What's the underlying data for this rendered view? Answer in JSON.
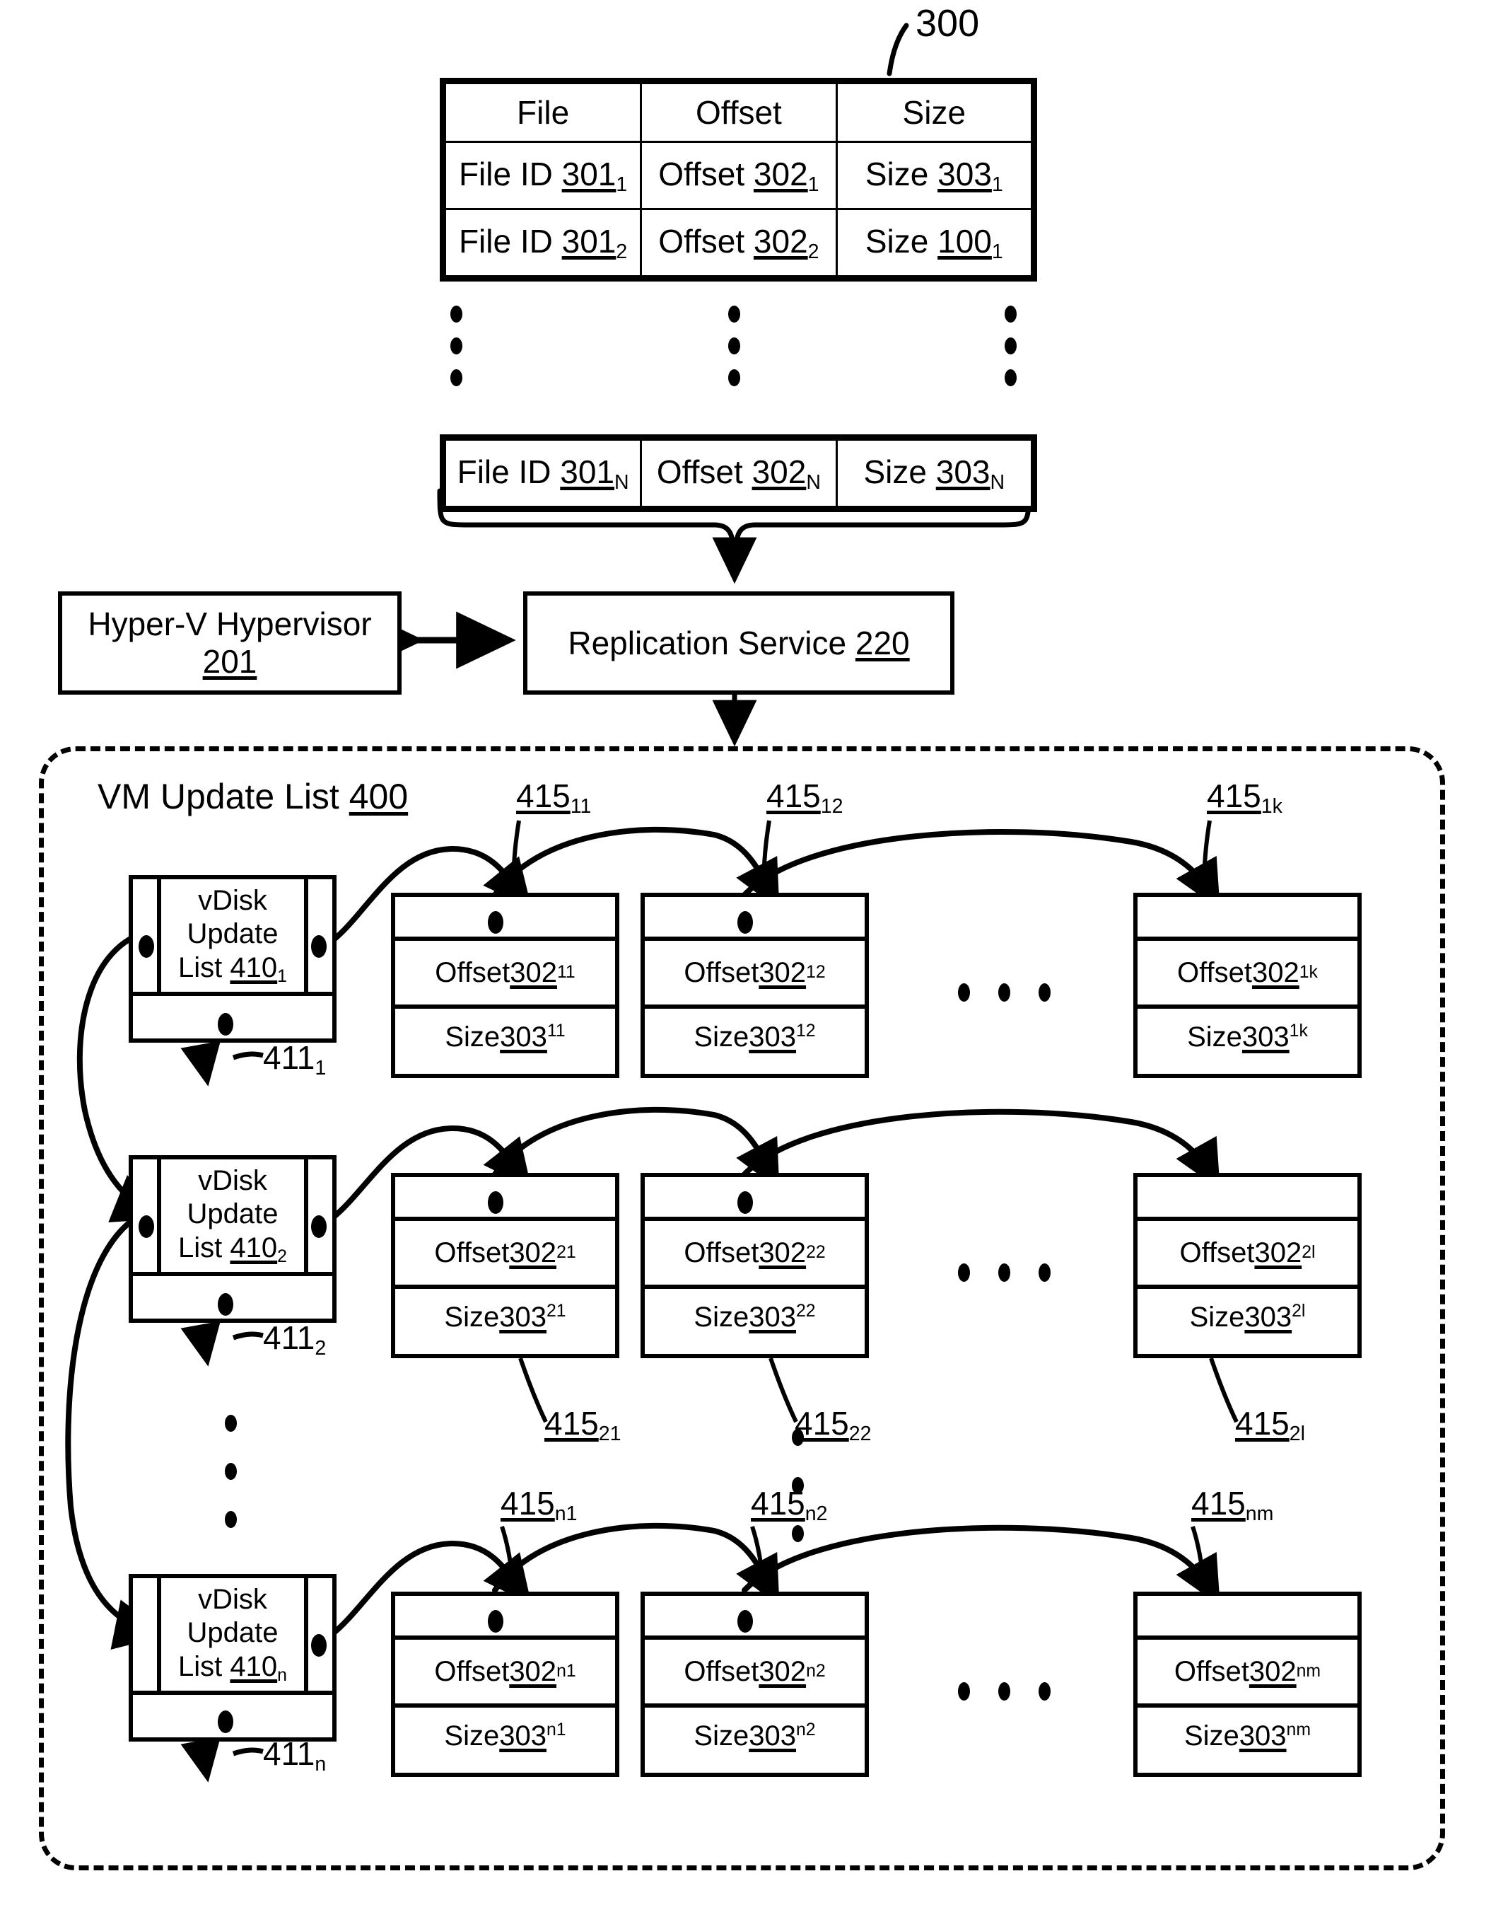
{
  "figure": {
    "table_ref": "300",
    "table": {
      "headers": [
        "File",
        "Offset",
        "Size"
      ],
      "rows": [
        {
          "file": "File ID 301",
          "file_sub": "1",
          "offset": "Offset 302",
          "offset_sub": "1",
          "size": "Size 303",
          "size_sub": "1"
        },
        {
          "file": "File ID 301",
          "file_sub": "2",
          "offset": "Offset 302",
          "offset_sub": "2",
          "size": "Size 100",
          "size_sub": "1"
        }
      ],
      "last_row": {
        "file": "File ID 301",
        "file_sub": "N",
        "offset": "Offset 302",
        "offset_sub": "N",
        "size": "Size 303",
        "size_sub": "N"
      },
      "ellipsis": "vertical-dots"
    },
    "hypervisor": {
      "label": "Hyper-V Hypervisor",
      "ref": "201"
    },
    "replication_service": {
      "label": "Replication Service ",
      "ref": "220"
    },
    "vm_update_list": {
      "label": "VM Update List ",
      "ref": "400",
      "rows": [
        {
          "vdisk": {
            "line1": "vDisk",
            "line2": "Update",
            "line3": "List ",
            "ref": "410",
            "ref_sub": "1"
          },
          "next_ptr_label": "411",
          "next_ptr_sub": "1",
          "entries": [
            {
              "ptr_label": "415",
              "ptr_sub": "11",
              "offset": "Offset 302",
              "offset_sub": "11",
              "size": "Size 303",
              "size_sub": "11",
              "label_pos": "above"
            },
            {
              "ptr_label": "415",
              "ptr_sub": "12",
              "offset": "Offset 302",
              "offset_sub": "12",
              "size": "Size 303",
              "size_sub": "12",
              "label_pos": "above"
            },
            {
              "ptr_label": "415",
              "ptr_sub": "1k",
              "offset": "Offset 302",
              "offset_sub": "1k",
              "size": "Size 303",
              "size_sub": "1k",
              "label_pos": "above"
            }
          ]
        },
        {
          "vdisk": {
            "line1": "vDisk",
            "line2": "Update",
            "line3": "List ",
            "ref": "410",
            "ref_sub": "2"
          },
          "next_ptr_label": "411",
          "next_ptr_sub": "2",
          "entries": [
            {
              "ptr_label": "415",
              "ptr_sub": "21",
              "offset": "Offset 302",
              "offset_sub": "21",
              "size": "Size 303",
              "size_sub": "21",
              "label_pos": "below"
            },
            {
              "ptr_label": "415",
              "ptr_sub": "22",
              "offset": "Offset 302",
              "offset_sub": "22",
              "size": "Size 303",
              "size_sub": "22",
              "label_pos": "below"
            },
            {
              "ptr_label": "415",
              "ptr_sub": "2l",
              "offset": "Offset 302",
              "offset_sub": "2l",
              "size": "Size 303",
              "size_sub": "2l",
              "label_pos": "below"
            }
          ]
        },
        {
          "vdisk": {
            "line1": "vDisk",
            "line2": "Update",
            "line3": "List ",
            "ref": "410",
            "ref_sub": "n"
          },
          "next_ptr_label": "411",
          "next_ptr_sub": "n",
          "entries": [
            {
              "ptr_label": "415",
              "ptr_sub": "n1",
              "offset": "Offset 302",
              "offset_sub": "n1",
              "size": "Size 303",
              "size_sub": "n1",
              "label_pos": "above"
            },
            {
              "ptr_label": "415",
              "ptr_sub": "n2",
              "offset": "Offset 302",
              "offset_sub": "n2",
              "size": "Size 303",
              "size_sub": "n2",
              "label_pos": "above"
            },
            {
              "ptr_label": "415",
              "ptr_sub": "nm",
              "offset": "Offset 302",
              "offset_sub": "nm",
              "size": "Size 303",
              "size_sub": "nm",
              "label_pos": "above"
            }
          ]
        }
      ]
    }
  }
}
